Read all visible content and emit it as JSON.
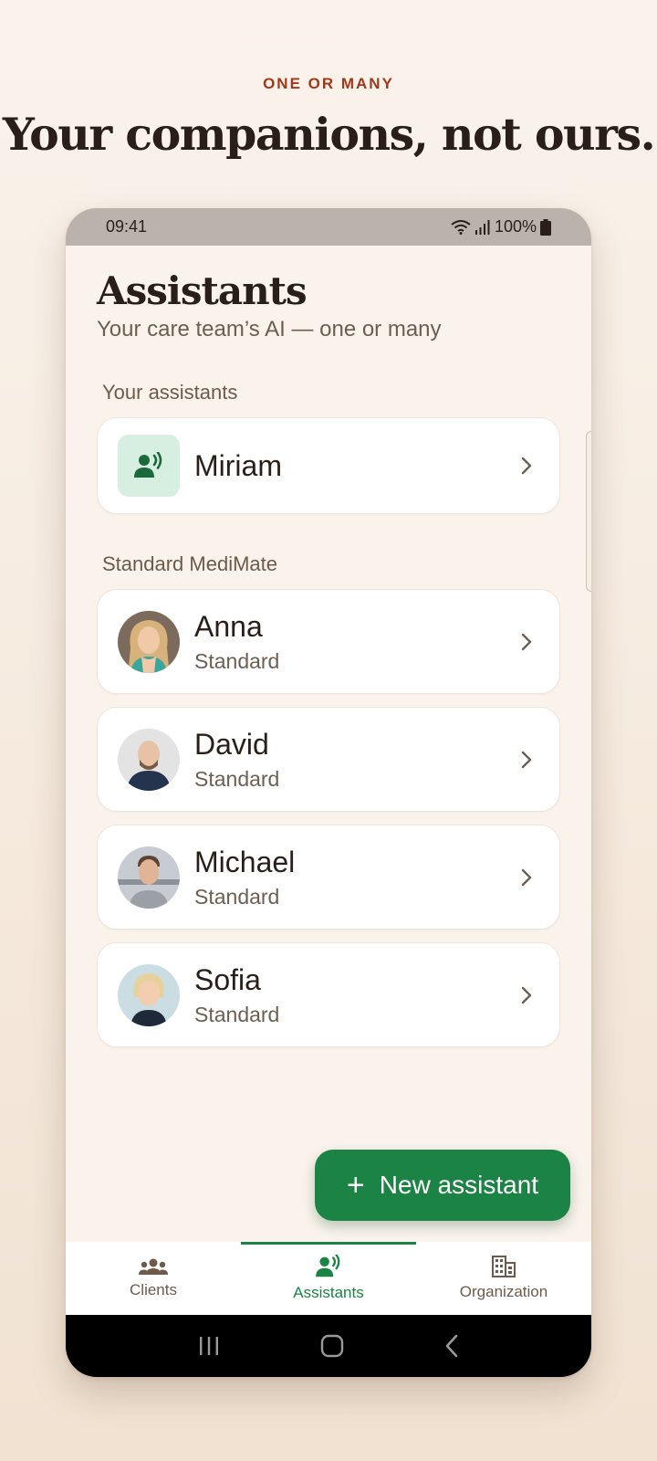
{
  "eyebrow": "ONE OR MANY",
  "headline": "Your companions, not ours.",
  "status": {
    "time": "09:41",
    "battery": "100%"
  },
  "header": {
    "title": "Assistants",
    "subtitle": "Your care team’s AI — one or many"
  },
  "your_assistants": {
    "label": "Your assistants",
    "items": [
      {
        "name": "Miriam",
        "icon": "voice-user-icon"
      }
    ]
  },
  "standard": {
    "label": "Standard MediMate",
    "items": [
      {
        "name": "Anna",
        "sub": "Standard"
      },
      {
        "name": "David",
        "sub": "Standard"
      },
      {
        "name": "Michael",
        "sub": "Standard"
      },
      {
        "name": "Sofia",
        "sub": "Standard"
      }
    ]
  },
  "fab": {
    "icon": "plus-icon",
    "label": "New assistant"
  },
  "nav": [
    {
      "label": "Clients",
      "icon": "people-icon",
      "active": false
    },
    {
      "label": "Assistants",
      "icon": "voice-user-icon",
      "active": true
    },
    {
      "label": "Organization",
      "icon": "building-icon",
      "active": false
    }
  ],
  "colors": {
    "accent_green": "#1b8344",
    "eyebrow_red": "#a0381a",
    "background": "#faf3ec",
    "tile_green": "#d6efe0"
  }
}
